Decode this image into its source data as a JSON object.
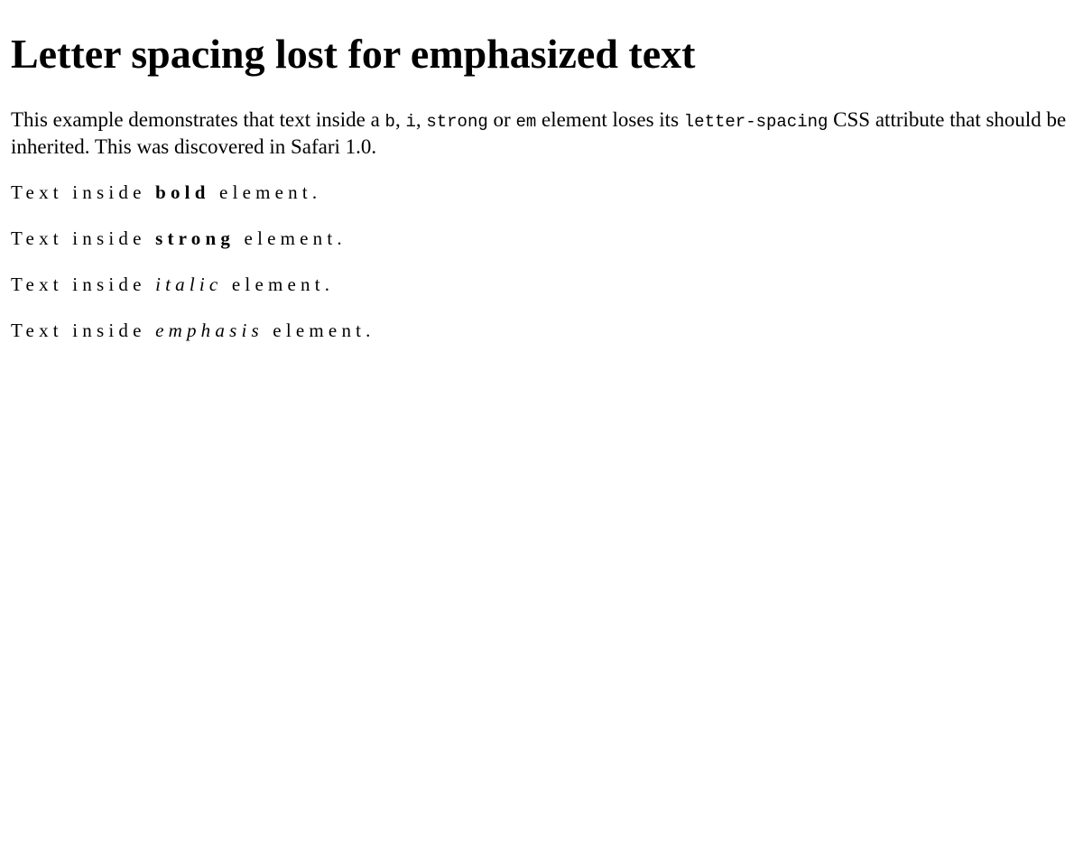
{
  "heading": "Letter spacing lost for emphasized text",
  "intro": {
    "t1": "This example demonstrates that text inside a ",
    "c1": "b",
    "t2": ", ",
    "c2": "i",
    "t3": ", ",
    "c3": "strong",
    "t4": " or ",
    "c4": "em",
    "t5": " element loses its ",
    "c5": "letter-spacing",
    "t6": " CSS attribute that should be inherited. This was discovered in Safari 1.0."
  },
  "examples": [
    {
      "prefix": "Text inside ",
      "emphasized": "bold",
      "suffix": " element."
    },
    {
      "prefix": "Text inside ",
      "emphasized": "strong",
      "suffix": " element."
    },
    {
      "prefix": "Text inside ",
      "emphasized": "italic",
      "suffix": " element."
    },
    {
      "prefix": "Text inside ",
      "emphasized": "emphasis",
      "suffix": " element."
    }
  ]
}
